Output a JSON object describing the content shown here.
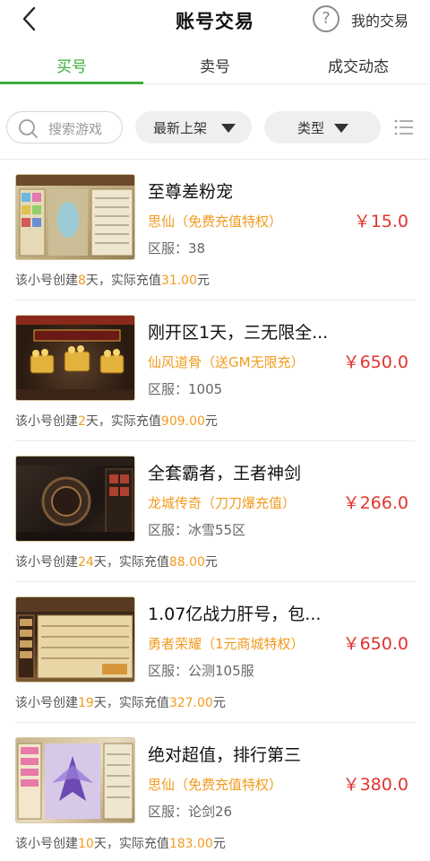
{
  "header": {
    "title": "账号交易",
    "my_trades_label": "我的交易",
    "help_icon": "question-circle-icon",
    "back_icon": "chevron-left-icon"
  },
  "tabs": [
    {
      "label": "买号",
      "active": true
    },
    {
      "label": "卖号",
      "active": false
    },
    {
      "label": "成交动态",
      "active": false
    }
  ],
  "filters": {
    "search_placeholder": "搜索游戏",
    "sort_label": "最新上架",
    "type_label": "类型"
  },
  "listings": [
    {
      "title": "至尊差粉宠",
      "game": "思仙（免费充值特权）",
      "server": "区服：38",
      "price": "￥15.0",
      "meta_prefix": "该小号创建",
      "days": "8",
      "meta_mid": "天，实际充值",
      "recharge": "31.00",
      "meta_suffix": "元"
    },
    {
      "title": "刚开区1天，三无限全...",
      "game": "仙风道骨（送GM无限充）",
      "server": "区服：1005",
      "price": "￥650.0",
      "meta_prefix": "该小号创建",
      "days": "2",
      "meta_mid": "天，实际充值",
      "recharge": "909.00",
      "meta_suffix": "元"
    },
    {
      "title": "全套霸者，王者神剑",
      "game": "龙城传奇（刀刀爆充值）",
      "server": "区服：冰雪55区",
      "price": "￥266.0",
      "meta_prefix": "该小号创建",
      "days": "24",
      "meta_mid": "天，实际充值",
      "recharge": "88.00",
      "meta_suffix": "元"
    },
    {
      "title": "1.07亿战力肝号，包...",
      "game": "勇者荣耀（1元商城特权）",
      "server": "区服：公测105服",
      "price": "￥650.0",
      "meta_prefix": "该小号创建",
      "days": "19",
      "meta_mid": "天，实际充值",
      "recharge": "327.00",
      "meta_suffix": "元"
    },
    {
      "title": "绝对超值，排行第三",
      "game": "思仙（免费充值特权）",
      "server": "区服：论剑26",
      "price": "￥380.0",
      "meta_prefix": "该小号创建",
      "days": "10",
      "meta_mid": "天，实际充值",
      "recharge": "183.00",
      "meta_suffix": "元"
    }
  ],
  "colors": {
    "accent_green": "#3bae3b",
    "price_red": "#e0342f",
    "highlight_orange": "#f19b1e"
  }
}
